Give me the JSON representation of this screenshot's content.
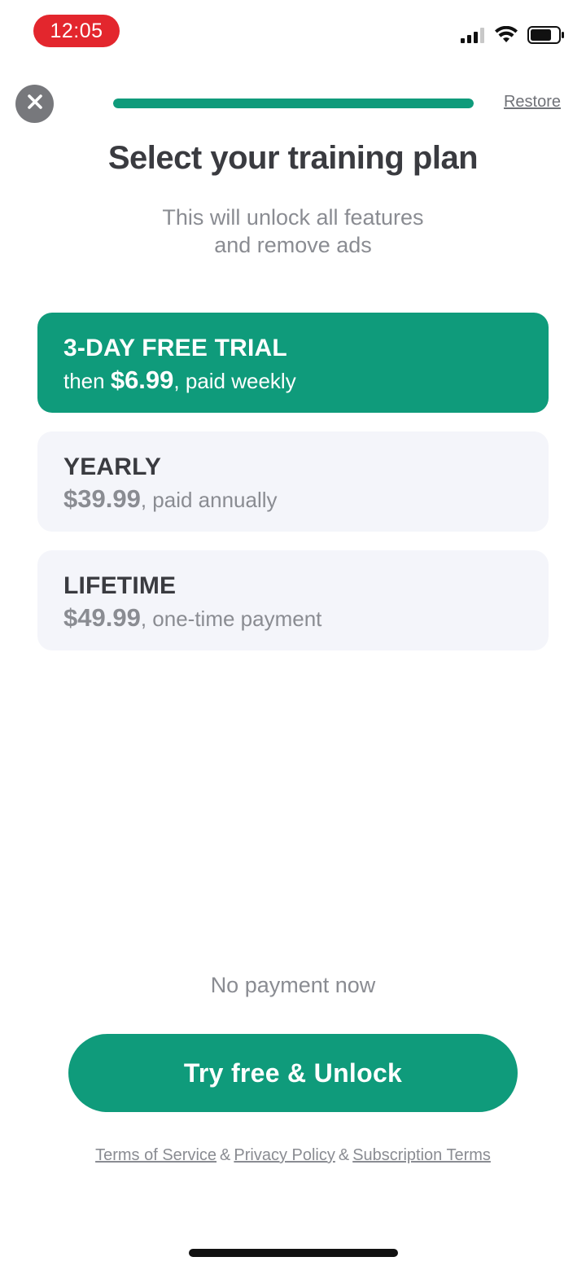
{
  "status_bar": {
    "time": "12:05",
    "time_pill_color": "#e3262d",
    "icons": [
      "cellular-signal-icon",
      "wifi-icon",
      "battery-icon"
    ]
  },
  "header": {
    "close_icon": "close-icon",
    "progress_fraction": 1.0,
    "restore_label": "Restore"
  },
  "title": "Select your training plan",
  "subtitle": {
    "line1": "This will unlock all features",
    "line2": "and remove ads"
  },
  "plans": [
    {
      "name": "3-DAY FREE TRIAL",
      "prefix": "then ",
      "price": "$6.99",
      "suffix": ", paid weekly",
      "selected": true
    },
    {
      "name": "YEARLY",
      "prefix": "",
      "price": "$39.99",
      "suffix": ", paid annually",
      "selected": false
    },
    {
      "name": "LIFETIME",
      "prefix": "",
      "price": "$49.99",
      "suffix": ", one-time payment",
      "selected": false
    }
  ],
  "no_payment_text": "No payment now",
  "cta_label": "Try free & Unlock",
  "legal": {
    "terms": "Terms of Service",
    "privacy": "Privacy Policy",
    "subscription": "Subscription Terms",
    "separator": "&"
  },
  "colors": {
    "accent": "#0f9b7b",
    "card_bg": "#f4f5fa",
    "text_dark": "#3a3b40",
    "text_muted": "#8a8c92"
  }
}
